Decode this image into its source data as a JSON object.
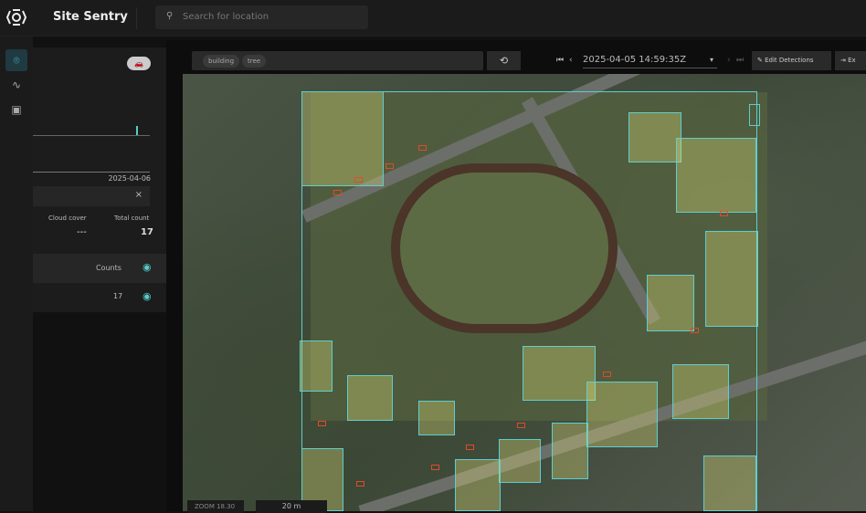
{
  "app": {
    "title": "Site Sentry"
  },
  "search": {
    "placeholder": "Search for location"
  },
  "panel": {
    "date": "2025-04-06",
    "cloud_cover_label": "Cloud cover",
    "cloud_cover_value": "---",
    "total_count_label": "Total count",
    "total_count_value": "17",
    "counts_label": "Counts",
    "row_count": "17",
    "close": "×"
  },
  "toolbar": {
    "chips": [
      "building",
      "tree"
    ],
    "timestamp": "2025-04-05 14:59:35Z",
    "edit_detections": "Edit Detections",
    "export": "Ex"
  },
  "map": {
    "zoom": "ZOOM 18.30",
    "scale": "20 m"
  },
  "colors": {
    "detection": "#5ccfcf",
    "vehicle": "#e04a2a"
  }
}
